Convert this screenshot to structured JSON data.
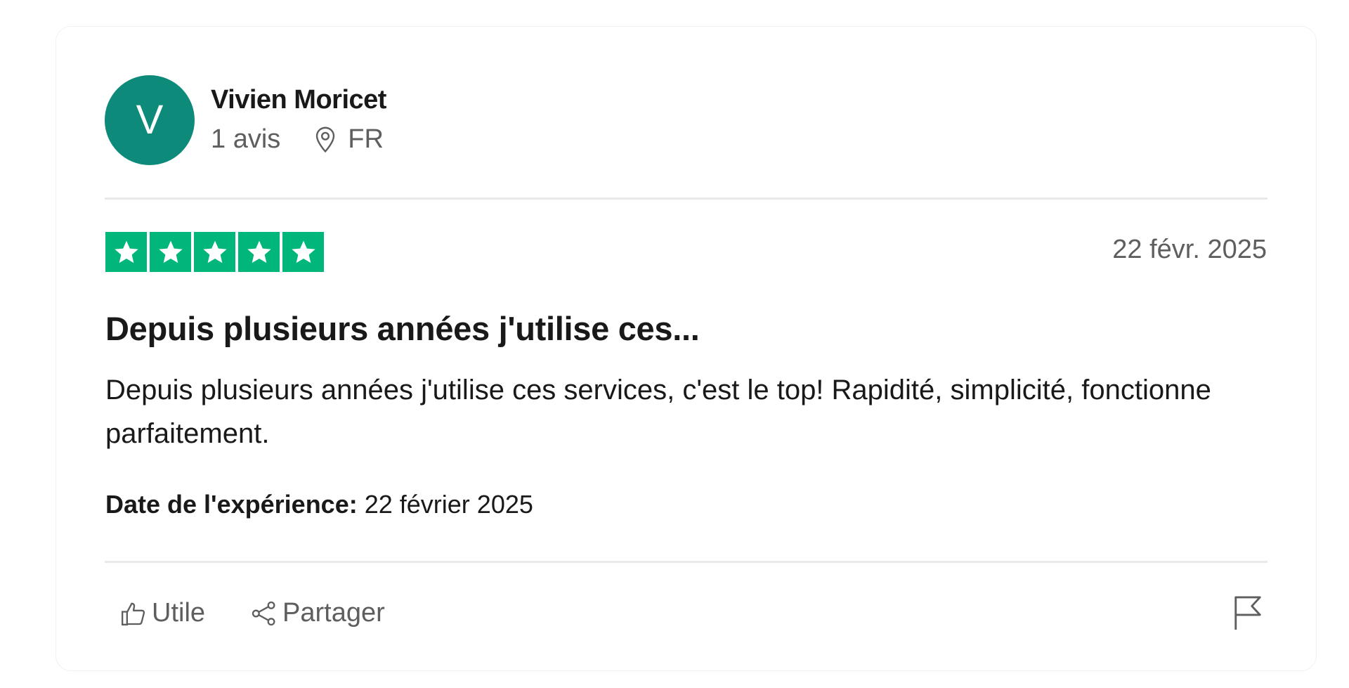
{
  "reviewer": {
    "initial": "V",
    "name": "Vivien Moricet",
    "review_count": "1 avis",
    "country": "FR",
    "avatar_color": "#0e8a7a",
    "location_icon": "location-pin-icon"
  },
  "review": {
    "rating": 5,
    "rating_max": 5,
    "star_color": "#00b67a",
    "date": "22 févr. 2025",
    "title": "Depuis plusieurs années j'utilise ces...",
    "body": "Depuis plusieurs années j'utilise ces services, c'est le top! Rapidité, simplicité, fonctionne parfaitement.",
    "experience_label": "Date de l'expérience:",
    "experience_date": "22 février 2025"
  },
  "actions": {
    "useful_label": "Utile",
    "useful_icon": "thumbs-up-icon",
    "share_label": "Partager",
    "share_icon": "share-icon",
    "report_icon": "flag-icon"
  }
}
